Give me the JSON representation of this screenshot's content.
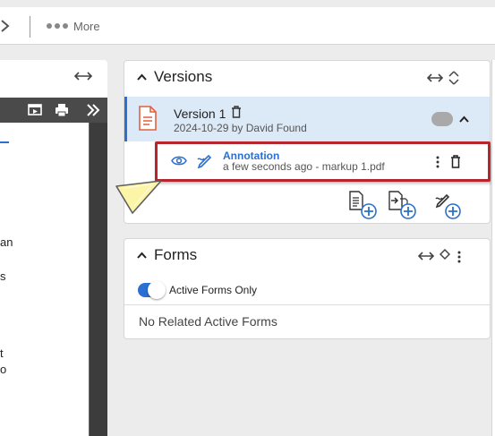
{
  "toolbar": {
    "more_label": "More"
  },
  "document_panel": {
    "text_fragments": [
      "an",
      "s",
      "t",
      "o"
    ]
  },
  "versions_panel": {
    "title": "Versions",
    "version": {
      "title": "Version 1",
      "subtitle": "2024-10-29 by David Found"
    },
    "annotation": {
      "name": "Annotation",
      "subtitle": "a few seconds ago - markup 1.pdf"
    }
  },
  "forms_panel": {
    "title": "Forms",
    "toggle_label": "Active Forms Only",
    "toggle_on": true,
    "empty_message": "No Related Active Forms"
  },
  "colors": {
    "accent": "#2a6fd1",
    "highlight": "#b8242b",
    "version_row_bg": "#dce9f7",
    "file_icon": "#e2603f",
    "pointer_fill": "#fcf5a7"
  }
}
